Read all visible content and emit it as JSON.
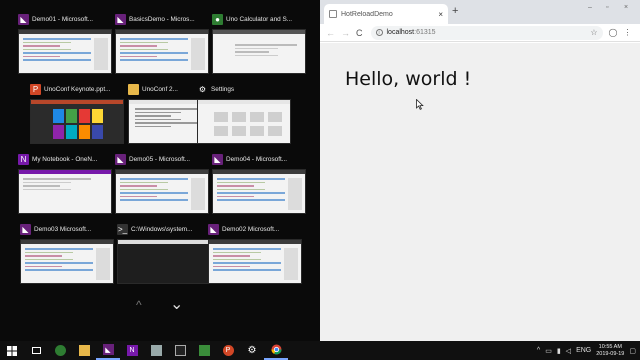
{
  "task_view": {
    "windows": [
      {
        "title": "Demo01 - Microsoft...",
        "icon": "visual-studio-icon"
      },
      {
        "title": "BasicsDemo - Micros...",
        "icon": "visual-studio-icon"
      },
      {
        "title": "Uno Calculator and S...",
        "icon": "uno-icon"
      },
      {
        "title": "UnoConf Keynote.ppt...",
        "icon": "powerpoint-icon"
      },
      {
        "title": "UnoConf 2...",
        "icon": "folder-icon"
      },
      {
        "title": "Settings",
        "icon": "gear-icon"
      },
      {
        "title": "My Notebook - OneN...",
        "icon": "onenote-icon"
      },
      {
        "title": "Demo05 - Microsoft...",
        "icon": "visual-studio-icon"
      },
      {
        "title": "Demo04 - Microsoft...",
        "icon": "visual-studio-icon"
      },
      {
        "title": "Demo03     Microsoft...",
        "icon": "visual-studio-icon"
      },
      {
        "title": "C:\\Windows\\system...",
        "icon": "cmd-icon"
      },
      {
        "title": "Demo02     Microsoft...",
        "icon": "visual-studio-icon"
      }
    ],
    "scroll_up": "^",
    "scroll_down": "⌄"
  },
  "browser": {
    "tab_title": "HotReloadDemo",
    "tab_close": "×",
    "new_tab": "+",
    "window_controls": {
      "minimize": "–",
      "restore": "▫",
      "close": "×"
    },
    "nav": {
      "back": "←",
      "forward": "→",
      "reload": "C"
    },
    "url_host": "localhost",
    "url_port": ":61315",
    "page_heading": "Hello, world !"
  },
  "taskbar": {
    "tray_lang": "ENG",
    "time": "10:55 AM",
    "date": "2019-09-19"
  },
  "colors": {
    "vs_purple": "#68217a",
    "task_view_bg": "#0a0a0a",
    "taskbar_bg": "#101010",
    "browser_tabstrip": "#dee1e6"
  }
}
